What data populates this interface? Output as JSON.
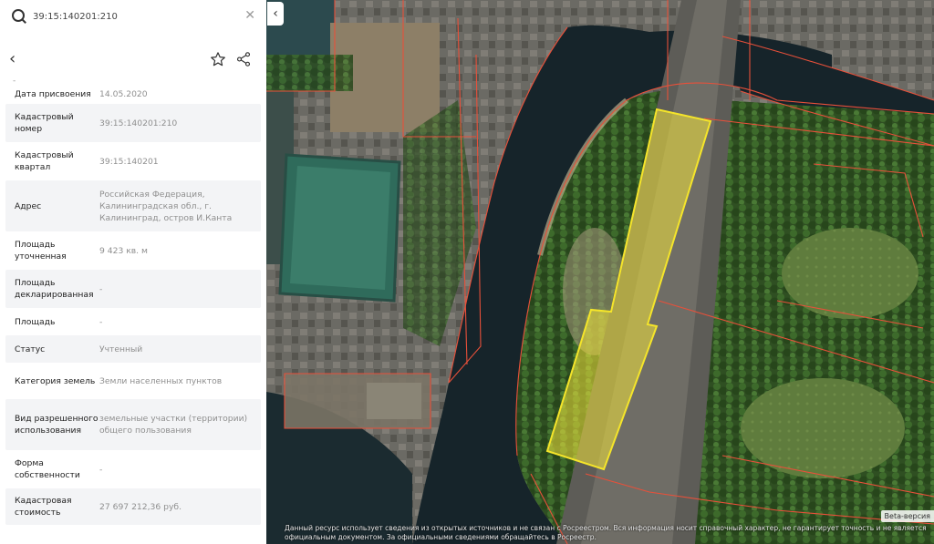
{
  "search": {
    "value": "39:15:140201:210",
    "clear_icon": "close-icon",
    "search_icon": "search-icon"
  },
  "toolbar": {
    "back_icon": "chevron-left-icon",
    "favorite_icon": "star-outline-icon",
    "share_icon": "share-icon"
  },
  "top_dash": "-",
  "properties": [
    {
      "label": "Дата присвоения",
      "value": "14.05.2020"
    },
    {
      "label": "Кадастровый номер",
      "value": "39:15:140201:210"
    },
    {
      "label": "Кадастровый квартал",
      "value": "39:15:140201"
    },
    {
      "label": "Адрес",
      "value": "Российская Федерация, Калининградская обл., г. Калининград, остров И.Канта"
    },
    {
      "label": "Площадь уточненная",
      "value": "9 423 кв. м"
    },
    {
      "label": "Площадь декларированная",
      "value": "-"
    },
    {
      "label": "Площадь",
      "value": "-"
    },
    {
      "label": "Статус",
      "value": "Учтенный"
    },
    {
      "label": "Категория земель",
      "value": "Земли населенных пунктов"
    },
    {
      "label": "Вид разрешенного использования",
      "value": "земельные участки (территории) общего пользования"
    },
    {
      "label": "Форма собственности",
      "value": "-"
    },
    {
      "label": "Кадастровая стоимость",
      "value": "27 697 212,36 руб."
    }
  ],
  "panel_toggle_icon": "chevron-left-icon",
  "map": {
    "disclaimer": "Данный ресурс использует сведения из открытых источников и не связан с Росреестром. Вся информация носит справочный характер, не гарантирует точность и не является официальным документом. За официальными сведениями обращайтесь в Росреестр.",
    "beta_label": "Beta-версия",
    "parcel_color": "#f2e43a",
    "boundary_color": "#e8503a",
    "water_color": "#16242a"
  }
}
